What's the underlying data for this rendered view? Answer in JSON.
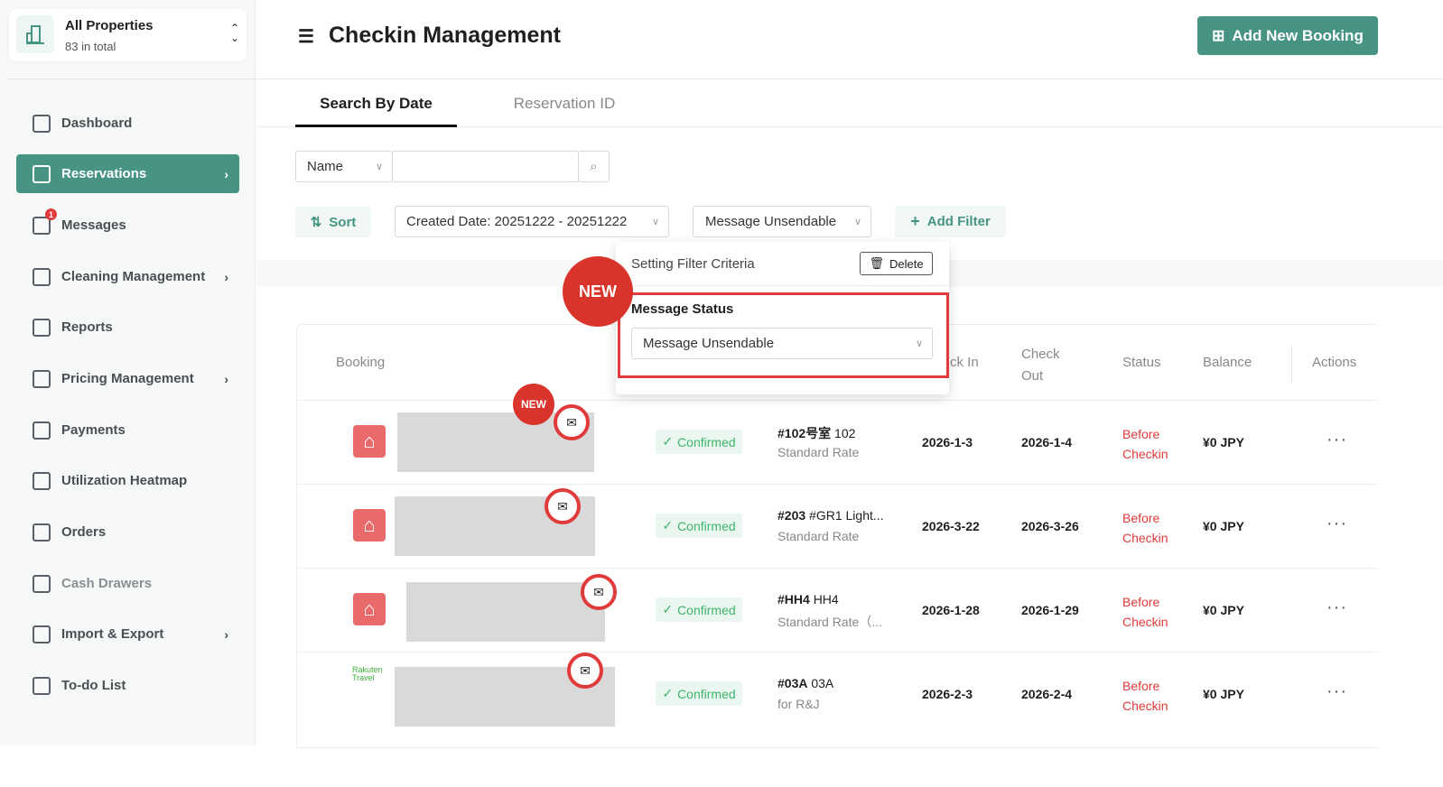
{
  "property": {
    "name": "All Properties",
    "count": "83 in total"
  },
  "sidebar": {
    "items": [
      {
        "label": "Dashboard",
        "chevron": false
      },
      {
        "label": "Reservations",
        "chevron": true,
        "active": true
      },
      {
        "label": "Messages",
        "chevron": false,
        "badge": "1"
      },
      {
        "label": "Cleaning Management",
        "chevron": true
      },
      {
        "label": "Reports",
        "chevron": false
      },
      {
        "label": "Pricing Management",
        "chevron": true
      },
      {
        "label": "Payments",
        "chevron": false
      },
      {
        "label": "Utilization Heatmap",
        "chevron": false
      },
      {
        "label": "Orders",
        "chevron": false
      },
      {
        "label": "Cash Drawers",
        "chevron": false,
        "disabled": true
      },
      {
        "label": "Import & Export",
        "chevron": true
      },
      {
        "label": "To-do List",
        "chevron": false
      }
    ]
  },
  "header": {
    "title": "Checkin Management",
    "add_button": "Add New Booking"
  },
  "tabs": [
    {
      "label": "Search By Date",
      "active": true
    },
    {
      "label": "Reservation ID"
    }
  ],
  "search": {
    "field": "Name",
    "value": ""
  },
  "filters": {
    "sort": "Sort",
    "created_date": "Created Date: 20251222 - 20251222",
    "message": "Message Unsendable",
    "add": "Add Filter"
  },
  "popup": {
    "title": "Setting Filter Criteria",
    "delete": "Delete",
    "new_label": "NEW",
    "field_label": "Message Status",
    "field_value": "Message Unsendable"
  },
  "table": {
    "headers": [
      "Booking",
      "ck In",
      "Check Out",
      "Status",
      "Balance",
      "Actions"
    ],
    "rows": [
      {
        "channel": "airbnb",
        "status": "Confirmed",
        "room": "#102号室",
        "room_name": "102",
        "rate": "Standard Rate",
        "checkin": "2026-1-3",
        "checkout": "2026-1-4",
        "state": "Before Checkin",
        "balance": "¥0 JPY",
        "new": "NEW"
      },
      {
        "channel": "airbnb",
        "status": "Confirmed",
        "room": "#203",
        "room_name": "#GR1 Light...",
        "rate": "Standard Rate",
        "checkin": "2026-3-22",
        "checkout": "2026-3-26",
        "state": "Before Checkin",
        "balance": "¥0 JPY"
      },
      {
        "channel": "airbnb",
        "status": "Confirmed",
        "room": "#HH4",
        "room_name": "HH4",
        "rate": "Standard Rate（...",
        "checkin": "2026-1-28",
        "checkout": "2026-1-29",
        "state": "Before Checkin",
        "balance": "¥0 JPY"
      },
      {
        "channel": "rakuten",
        "channel_text": "Rakuten Travel",
        "status": "Confirmed",
        "room": "#03A",
        "room_name": "03A",
        "rate": "for R&J",
        "checkin": "2026-2-3",
        "checkout": "2026-2-4",
        "state": "Before Checkin",
        "balance": "¥0 JPY"
      }
    ]
  },
  "colors": {
    "accent": "#479485",
    "danger": "#e03a3a",
    "confirmed": "#3fb36c"
  }
}
